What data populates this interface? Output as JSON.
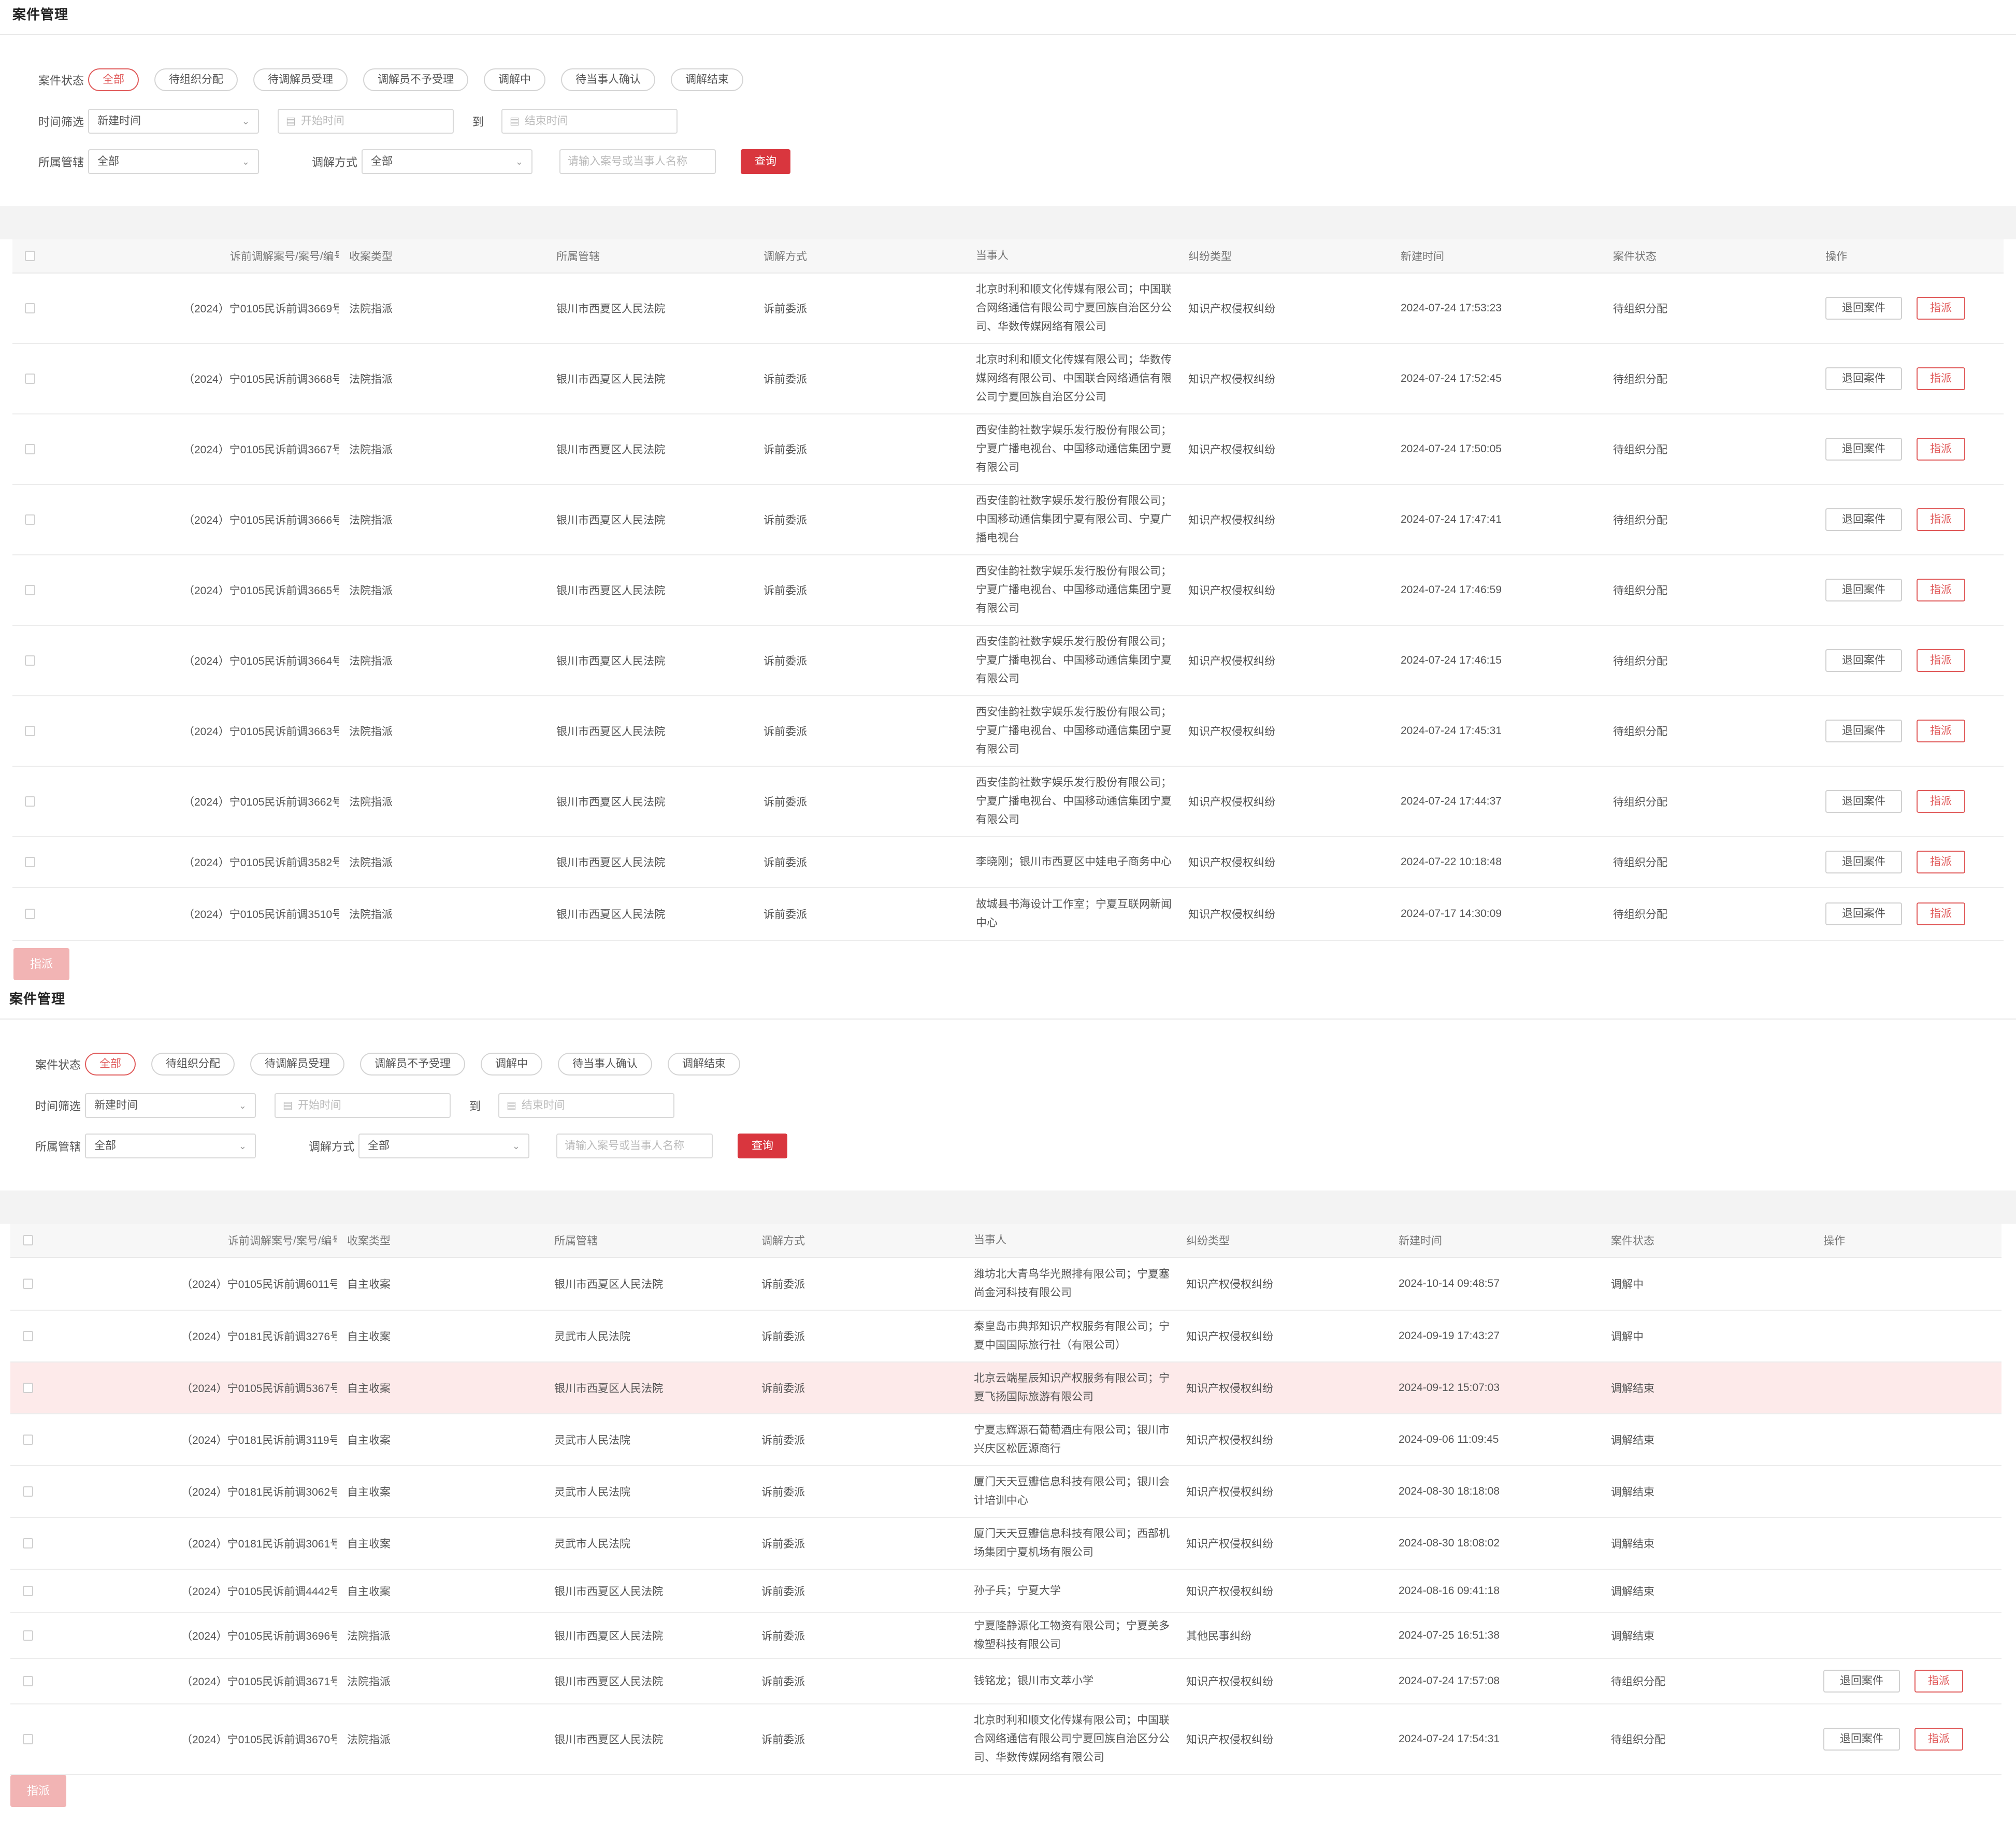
{
  "page_title": "案件管理",
  "filters": {
    "status_label": "案件状态",
    "status_chips": [
      "全部",
      "待组织分配",
      "待调解员受理",
      "调解员不予受理",
      "调解中",
      "待当事人确认",
      "调解结束"
    ],
    "time_label": "时间筛选",
    "time_select": "新建时间",
    "start_placeholder": "开始时间",
    "to_label": "到",
    "end_placeholder": "结束时间",
    "court_label": "所属管辖",
    "court_select": "全部",
    "method_label": "调解方式",
    "method_select": "全部",
    "search_placeholder": "请输入案号或当事人名称",
    "query_button": "查询"
  },
  "table_headers": {
    "case_no": "诉前调解案号/案号/编号",
    "receive_type": "收案类型",
    "court": "所属管辖",
    "method": "调解方式",
    "party": "当事人",
    "dispute": "纠纷类型",
    "created": "新建时间",
    "status": "案件状态",
    "ops": "操作"
  },
  "actions": {
    "recall": "退回案件",
    "assign": "指派",
    "batch_assign": "指派"
  },
  "panel_a_rows": [
    {
      "case_no": "（2024）宁0105民诉前调3669号",
      "receive_type": "法院指派",
      "court": "银川市西夏区人民法院",
      "method": "诉前委派",
      "party": "北京时利和顺文化传媒有限公司；中国联合网络通信有限公司宁夏回族自治区分公司、华数传媒网络有限公司",
      "dispute": "知识产权侵权纠纷",
      "created": "2024-07-24 17:53:23",
      "status": "待组织分配",
      "ops": true
    },
    {
      "case_no": "（2024）宁0105民诉前调3668号",
      "receive_type": "法院指派",
      "court": "银川市西夏区人民法院",
      "method": "诉前委派",
      "party": "北京时利和顺文化传媒有限公司；华数传媒网络有限公司、中国联合网络通信有限公司宁夏回族自治区分公司",
      "dispute": "知识产权侵权纠纷",
      "created": "2024-07-24 17:52:45",
      "status": "待组织分配",
      "ops": true
    },
    {
      "case_no": "（2024）宁0105民诉前调3667号",
      "receive_type": "法院指派",
      "court": "银川市西夏区人民法院",
      "method": "诉前委派",
      "party": "西安佳韵社数字娱乐发行股份有限公司；宁夏广播电视台、中国移动通信集团宁夏有限公司",
      "dispute": "知识产权侵权纠纷",
      "created": "2024-07-24 17:50:05",
      "status": "待组织分配",
      "ops": true
    },
    {
      "case_no": "（2024）宁0105民诉前调3666号",
      "receive_type": "法院指派",
      "court": "银川市西夏区人民法院",
      "method": "诉前委派",
      "party": "西安佳韵社数字娱乐发行股份有限公司；中国移动通信集团宁夏有限公司、宁夏广播电视台",
      "dispute": "知识产权侵权纠纷",
      "created": "2024-07-24 17:47:41",
      "status": "待组织分配",
      "ops": true
    },
    {
      "case_no": "（2024）宁0105民诉前调3665号",
      "receive_type": "法院指派",
      "court": "银川市西夏区人民法院",
      "method": "诉前委派",
      "party": "西安佳韵社数字娱乐发行股份有限公司；宁夏广播电视台、中国移动通信集团宁夏有限公司",
      "dispute": "知识产权侵权纠纷",
      "created": "2024-07-24 17:46:59",
      "status": "待组织分配",
      "ops": true
    },
    {
      "case_no": "（2024）宁0105民诉前调3664号",
      "receive_type": "法院指派",
      "court": "银川市西夏区人民法院",
      "method": "诉前委派",
      "party": "西安佳韵社数字娱乐发行股份有限公司；宁夏广播电视台、中国移动通信集团宁夏有限公司",
      "dispute": "知识产权侵权纠纷",
      "created": "2024-07-24 17:46:15",
      "status": "待组织分配",
      "ops": true
    },
    {
      "case_no": "（2024）宁0105民诉前调3663号",
      "receive_type": "法院指派",
      "court": "银川市西夏区人民法院",
      "method": "诉前委派",
      "party": "西安佳韵社数字娱乐发行股份有限公司；宁夏广播电视台、中国移动通信集团宁夏有限公司",
      "dispute": "知识产权侵权纠纷",
      "created": "2024-07-24 17:45:31",
      "status": "待组织分配",
      "ops": true
    },
    {
      "case_no": "（2024）宁0105民诉前调3662号",
      "receive_type": "法院指派",
      "court": "银川市西夏区人民法院",
      "method": "诉前委派",
      "party": "西安佳韵社数字娱乐发行股份有限公司；宁夏广播电视台、中国移动通信集团宁夏有限公司",
      "dispute": "知识产权侵权纠纷",
      "created": "2024-07-24 17:44:37",
      "status": "待组织分配",
      "ops": true
    },
    {
      "case_no": "（2024）宁0105民诉前调3582号",
      "receive_type": "法院指派",
      "court": "银川市西夏区人民法院",
      "method": "诉前委派",
      "party": "李晓刚；银川市西夏区中娃电子商务中心",
      "dispute": "知识产权侵权纠纷",
      "created": "2024-07-22 10:18:48",
      "status": "待组织分配",
      "ops": true
    },
    {
      "case_no": "（2024）宁0105民诉前调3510号",
      "receive_type": "法院指派",
      "court": "银川市西夏区人民法院",
      "method": "诉前委派",
      "party": "故城县书海设计工作室；宁夏互联网新闻中心",
      "dispute": "知识产权侵权纠纷",
      "created": "2024-07-17 14:30:09",
      "status": "待组织分配",
      "ops": true
    }
  ],
  "panel_b_rows": [
    {
      "case_no": "（2024）宁0105民诉前调6011号",
      "receive_type": "自主收案",
      "court": "银川市西夏区人民法院",
      "method": "诉前委派",
      "party": "潍坊北大青鸟华光照排有限公司；宁夏塞尚金河科技有限公司",
      "dispute": "知识产权侵权纠纷",
      "created": "2024-10-14 09:48:57",
      "status": "调解中",
      "ops": false
    },
    {
      "case_no": "（2024）宁0181民诉前调3276号",
      "receive_type": "自主收案",
      "court": "灵武市人民法院",
      "method": "诉前委派",
      "party": "秦皇岛市典邦知识产权服务有限公司；宁夏中国国际旅行社（有限公司）",
      "dispute": "知识产权侵权纠纷",
      "created": "2024-09-19 17:43:27",
      "status": "调解中",
      "ops": false
    },
    {
      "case_no": "（2024）宁0105民诉前调5367号",
      "receive_type": "自主收案",
      "court": "银川市西夏区人民法院",
      "method": "诉前委派",
      "party": "北京云端星辰知识产权服务有限公司；宁夏飞扬国际旅游有限公司",
      "dispute": "知识产权侵权纠纷",
      "created": "2024-09-12 15:07:03",
      "status": "调解结束",
      "ops": false
    },
    {
      "case_no": "（2024）宁0181民诉前调3119号",
      "receive_type": "自主收案",
      "court": "灵武市人民法院",
      "method": "诉前委派",
      "party": "宁夏志辉源石葡萄酒庄有限公司；银川市兴庆区松匠源商行",
      "dispute": "知识产权侵权纠纷",
      "created": "2024-09-06 11:09:45",
      "status": "调解结束",
      "ops": false
    },
    {
      "case_no": "（2024）宁0181民诉前调3062号",
      "receive_type": "自主收案",
      "court": "灵武市人民法院",
      "method": "诉前委派",
      "party": "厦门天天豆瓣信息科技有限公司；银川会计培训中心",
      "dispute": "知识产权侵权纠纷",
      "created": "2024-08-30 18:18:08",
      "status": "调解结束",
      "ops": false
    },
    {
      "case_no": "（2024）宁0181民诉前调3061号",
      "receive_type": "自主收案",
      "court": "灵武市人民法院",
      "method": "诉前委派",
      "party": "厦门天天豆瓣信息科技有限公司；西部机场集团宁夏机场有限公司",
      "dispute": "知识产权侵权纠纷",
      "created": "2024-08-30 18:08:02",
      "status": "调解结束",
      "ops": false
    },
    {
      "case_no": "（2024）宁0105民诉前调4442号",
      "receive_type": "自主收案",
      "court": "银川市西夏区人民法院",
      "method": "诉前委派",
      "party": "孙子兵；宁夏大学",
      "dispute": "知识产权侵权纠纷",
      "created": "2024-08-16 09:41:18",
      "status": "调解结束",
      "ops": false
    },
    {
      "case_no": "（2024）宁0105民诉前调3696号",
      "receive_type": "法院指派",
      "court": "银川市西夏区人民法院",
      "method": "诉前委派",
      "party": "宁夏隆静源化工物资有限公司；宁夏美多橡塑科技有限公司",
      "dispute": "其他民事纠纷",
      "created": "2024-07-25 16:51:38",
      "status": "调解结束",
      "ops": false
    },
    {
      "case_no": "（2024）宁0105民诉前调3671号",
      "receive_type": "法院指派",
      "court": "银川市西夏区人民法院",
      "method": "诉前委派",
      "party": "钱铭龙；银川市文萃小学",
      "dispute": "知识产权侵权纠纷",
      "created": "2024-07-24 17:57:08",
      "status": "待组织分配",
      "ops": true
    },
    {
      "case_no": "（2024）宁0105民诉前调3670号",
      "receive_type": "法院指派",
      "court": "银川市西夏区人民法院",
      "method": "诉前委派",
      "party": "北京时利和顺文化传媒有限公司；中国联合网络通信有限公司宁夏回族自治区分公司、华数传媒网络有限公司",
      "dispute": "知识产权侵权纠纷",
      "created": "2024-07-24 17:54:31",
      "status": "待组织分配",
      "ops": true
    }
  ],
  "colors": {
    "accent": "#d9363e",
    "chip_active": "#e05a5a",
    "highlight_row": "#fdeaea",
    "batch_disabled": "#f2b4b4"
  },
  "icons": {
    "calendar": "calendar-icon",
    "chevron": "chevron-down-icon"
  }
}
